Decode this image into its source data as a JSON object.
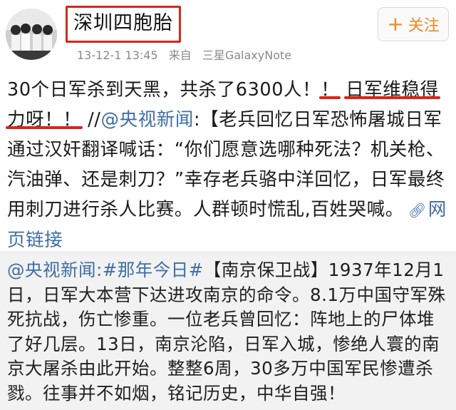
{
  "header": {
    "username": "深圳四胞胎",
    "timestamp": "13-12-1 13:45",
    "source_prefix": "来自",
    "source_device": "三星GalaxyNote",
    "follow_label": "关注",
    "follow_icon": "plus-icon"
  },
  "post": {
    "line1_a": "30个日军杀到天黑，共杀了6300人！",
    "line1_b": "！",
    "line1_c": "日军维稳得",
    "line2_a": "力呀！！",
    "line2_b": " //",
    "mention": "@央视新闻",
    "line2_c": ":【老兵回忆日军恐怖屠城",
    "body": "日军通过汉奸翻译喊话：“你们愿意选哪种死法？机关枪、汽油弹、还是刺刀？”幸存老兵骆中洋回忆，日军最终用刺刀进行杀人比赛。人群顿时慌乱,百姓哭喊。",
    "link_label": "网页链接",
    "link_icon": "link-icon"
  },
  "repost": {
    "mention": "@央视新闻",
    "hashtag": ":#那年今日#",
    "text": "【南京保卫战】1937年12月1日，日军大本营下达进攻南京的命令。8.1万中国守军殊死抗战，伤亡惨重。一位老兵曾回忆：阵地上的尸体堆了好几层。13日，南京沦陷，日军入城，惨绝人寰的南京大屠杀由此开始。整整6周，30多万中国军民惨遭杀戮。往事并不如烟，铭记历史，中华自强！"
  },
  "colors": {
    "highlight_red": "#d8261c",
    "link_blue": "#3d6ea8",
    "follow_orange": "#f08a24"
  }
}
